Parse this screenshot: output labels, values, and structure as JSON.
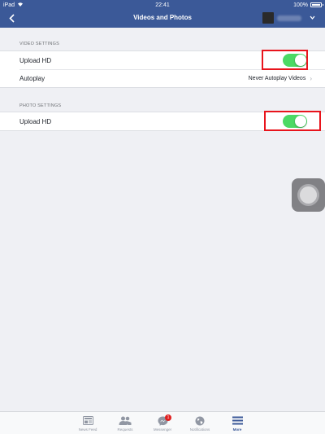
{
  "status_bar": {
    "device": "iPad",
    "time": "22:41",
    "battery": "100%"
  },
  "nav": {
    "title": "Videos and Photos"
  },
  "video_settings": {
    "header": "VIDEO SETTINGS",
    "upload_hd": {
      "label": "Upload HD",
      "on": true
    },
    "autoplay": {
      "label": "Autoplay",
      "value": "Never Autoplay Videos"
    }
  },
  "photo_settings": {
    "header": "PHOTO SETTINGS",
    "upload_hd": {
      "label": "Upload HD",
      "on": true
    }
  },
  "tabbar": {
    "items": [
      {
        "label": "News Feed",
        "icon": "news-feed-icon"
      },
      {
        "label": "Requests",
        "icon": "friend-requests-icon"
      },
      {
        "label": "Messenger",
        "icon": "messenger-icon",
        "badge": "1"
      },
      {
        "label": "Notifications",
        "icon": "globe-icon"
      },
      {
        "label": "More",
        "icon": "menu-icon",
        "active": true
      }
    ]
  },
  "colors": {
    "brand": "#3b5998",
    "toggle_on": "#4cd964",
    "highlight": "#e8141c"
  }
}
